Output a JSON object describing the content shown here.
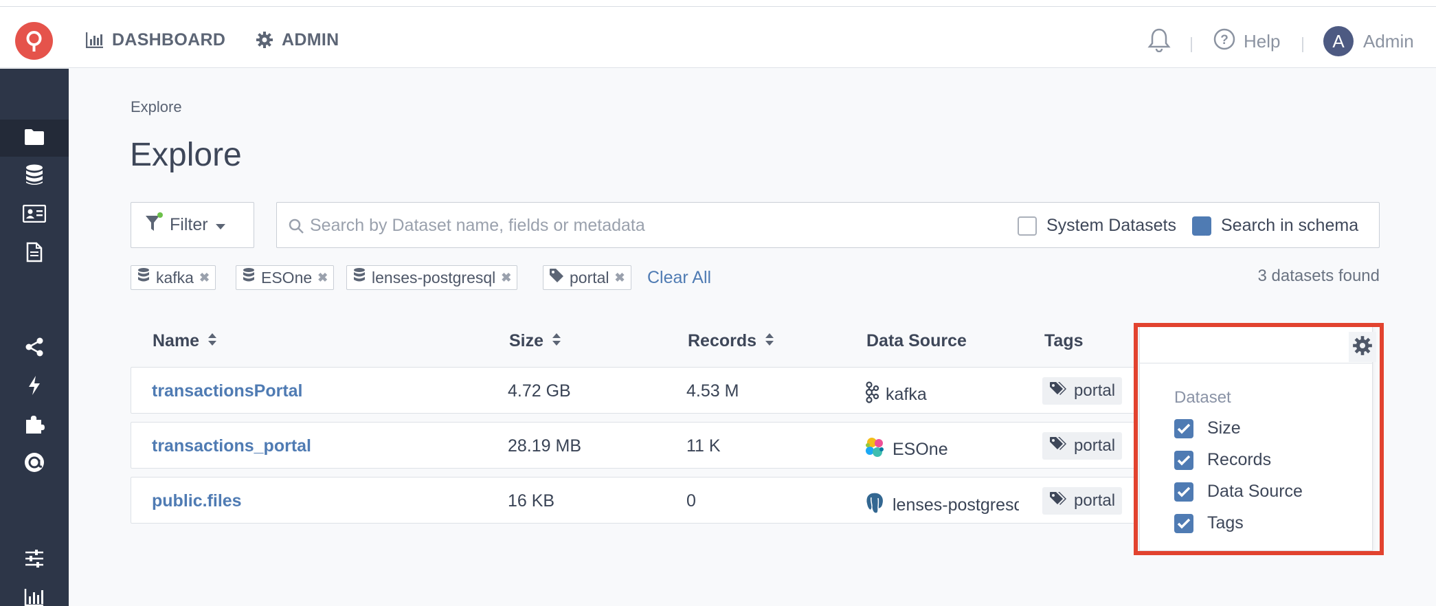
{
  "nav": {
    "logo": "lenses-logo",
    "items": [
      {
        "label": "DASHBOARD",
        "icon": "bar-chart-icon"
      },
      {
        "label": "ADMIN",
        "icon": "gear-icon"
      }
    ],
    "help_label": "Help",
    "user_initial": "A",
    "user_name": "Admin"
  },
  "sidebar": {
    "items": [
      "folder-icon",
      "database-icon",
      "id-card-icon",
      "document-icon",
      "share-icon",
      "bolt-icon",
      "puzzle-icon",
      "at-icon",
      "sliders-icon",
      "bar-chart-icon"
    ],
    "active": "folder-icon"
  },
  "breadcrumb": "Explore",
  "page_title": "Explore",
  "filter_label": "Filter",
  "search": {
    "placeholder": "Search by Dataset name, fields or metadata",
    "value": "",
    "system_datasets": {
      "label": "System Datasets",
      "checked": false
    },
    "search_in_schema": {
      "label": "Search in schema",
      "checked": true
    }
  },
  "chips": [
    "kafka",
    "ESOne",
    "lenses-postgresql",
    "portal"
  ],
  "clear_all": "Clear All",
  "results_count": "3 datasets found",
  "table": {
    "headers": {
      "name": "Name",
      "size": "Size",
      "records": "Records",
      "source": "Data Source",
      "tags": "Tags"
    },
    "rows": [
      {
        "name": "transactionsPortal",
        "size": "4.72 GB",
        "records": "4.53 M",
        "source": "kafka",
        "tag": "portal"
      },
      {
        "name": "transactions_portal",
        "size": "28.19 MB",
        "records": "11 K",
        "source": "ESOne",
        "tag": "portal"
      },
      {
        "name": "public.files",
        "size": "16 KB",
        "records": "0",
        "source": "lenses-postgresql",
        "tag": "portal"
      }
    ]
  },
  "columns_panel": {
    "title": "Dataset",
    "options": [
      {
        "label": "Size",
        "checked": true
      },
      {
        "label": "Records",
        "checked": true
      },
      {
        "label": "Data Source",
        "checked": true
      },
      {
        "label": "Tags",
        "checked": true
      }
    ]
  },
  "colors": {
    "accent": "#4f7bb3",
    "sidebar": "#2d3648",
    "logo": "#e5534b",
    "highlight": "#e2432f"
  }
}
